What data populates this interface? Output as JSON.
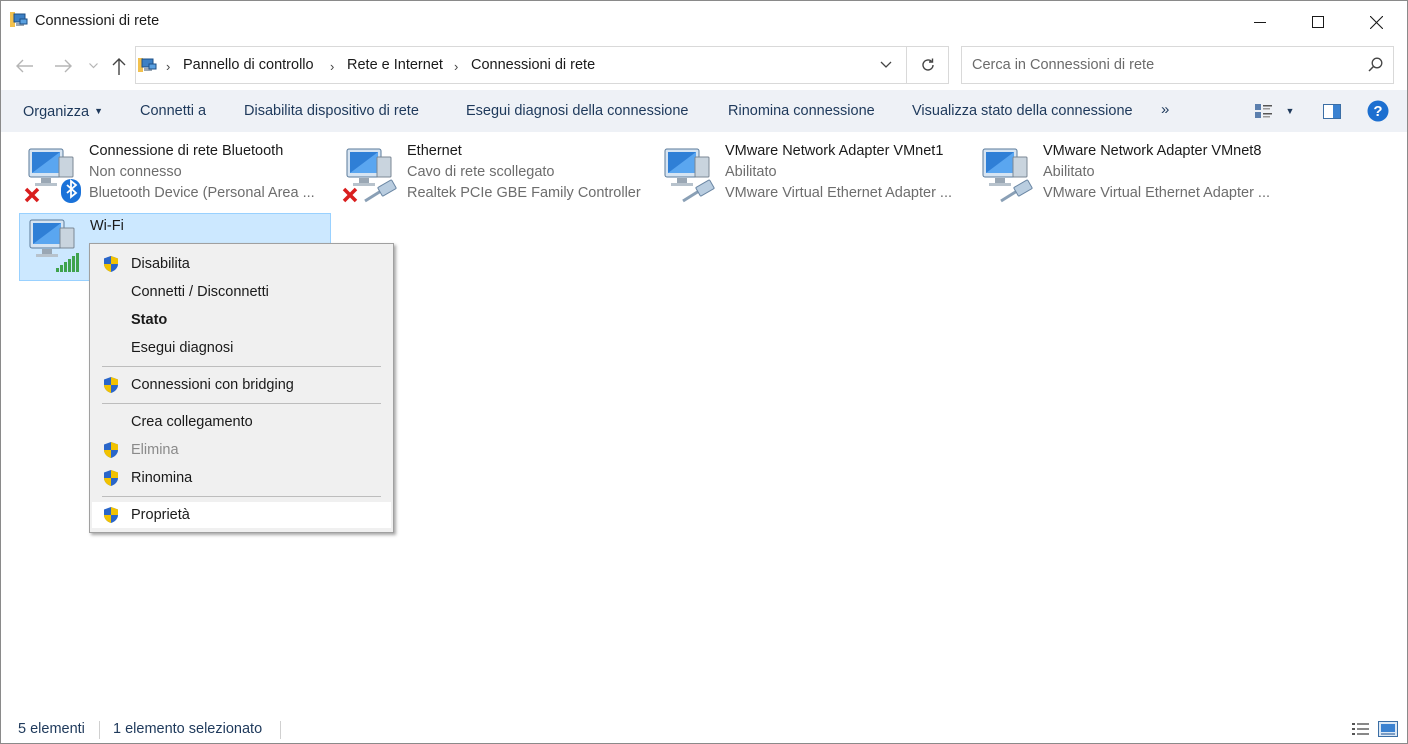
{
  "window": {
    "title": "Connessioni di rete"
  },
  "breadcrumb": {
    "items": [
      "Pannello di controllo",
      "Rete e Internet",
      "Connessioni di rete"
    ],
    "separator": "›"
  },
  "search": {
    "placeholder": "Cerca in Connessioni di rete"
  },
  "toolbar": {
    "organize": "Organizza",
    "connect": "Connetti a",
    "disable": "Disabilita dispositivo di rete",
    "diagnose": "Esegui diagnosi della connessione",
    "rename": "Rinomina connessione",
    "status": "Visualizza stato della connessione",
    "more": "»",
    "help_glyph": "?"
  },
  "connections": [
    {
      "name": "Connessione di rete Bluetooth",
      "status": "Non connesso",
      "device": "Bluetooth Device (Personal Area ...",
      "icon": "bluetooth-adapter-icon",
      "badge": "disconnected-x-icon"
    },
    {
      "name": "Ethernet",
      "status": "Cavo di rete scollegato",
      "device": "Realtek PCIe GBE Family Controller",
      "icon": "ethernet-adapter-icon",
      "badge": "disconnected-x-icon"
    },
    {
      "name": "VMware Network Adapter VMnet1",
      "status": "Abilitato",
      "device": "VMware Virtual Ethernet Adapter ...",
      "icon": "ethernet-adapter-icon",
      "badge": ""
    },
    {
      "name": "VMware Network Adapter VMnet8",
      "status": "Abilitato",
      "device": "VMware Virtual Ethernet Adapter ...",
      "icon": "ethernet-adapter-icon",
      "badge": ""
    },
    {
      "name": "Wi-Fi",
      "status": "",
      "device": "",
      "icon": "wifi-adapter-icon",
      "badge": "signal-bars-icon",
      "selected": true
    }
  ],
  "context_menu": {
    "items": [
      {
        "label": "Disabilita",
        "shield": true,
        "bold": false,
        "disabled": false
      },
      {
        "label": "Connetti / Disconnetti",
        "shield": false,
        "bold": false,
        "disabled": false
      },
      {
        "label": "Stato",
        "shield": false,
        "bold": true,
        "disabled": false
      },
      {
        "label": "Esegui diagnosi",
        "shield": false,
        "bold": false,
        "disabled": false
      },
      {
        "label": "Connessioni con bridging",
        "shield": true,
        "bold": false,
        "disabled": false
      },
      {
        "label": "Crea collegamento",
        "shield": false,
        "bold": false,
        "disabled": false
      },
      {
        "label": "Elimina",
        "shield": true,
        "bold": false,
        "disabled": true
      },
      {
        "label": "Rinomina",
        "shield": true,
        "bold": false,
        "disabled": false
      },
      {
        "label": "Proprietà",
        "shield": true,
        "bold": false,
        "disabled": false,
        "highlighted": true
      }
    ]
  },
  "statusbar": {
    "count": "5 elementi",
    "selection": "1 elemento selezionato"
  },
  "colors": {
    "accent": "#0078d7",
    "selection_bg": "#cce8ff",
    "selection_border": "#99d1ff",
    "command_bar_bg": "#eef1f6",
    "command_text": "#1e395b",
    "secondary_text": "#6d6d6d",
    "disabled_text": "#8a8a8a"
  }
}
